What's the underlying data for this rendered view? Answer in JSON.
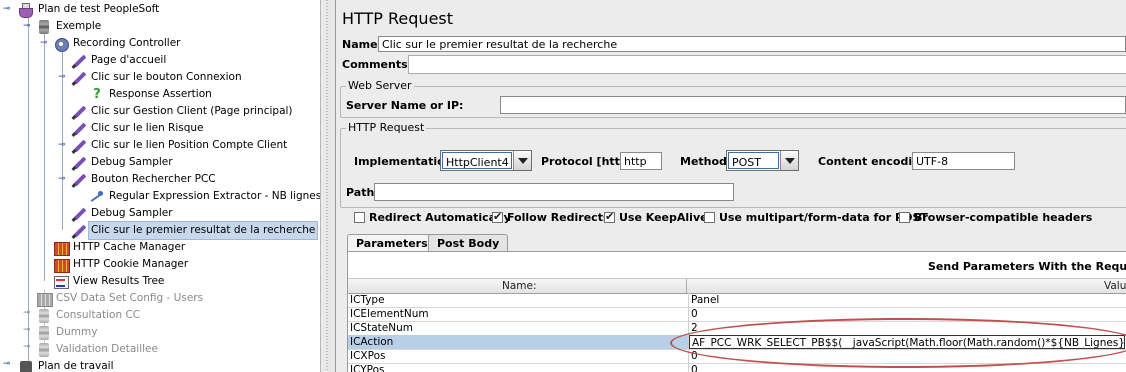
{
  "tree": {
    "items": [
      {
        "label": "Plan de test PeopleSoft",
        "icon": "beaker-icon",
        "disabled": false
      },
      {
        "label": "Exemple",
        "icon": "thread-group-icon",
        "disabled": false
      },
      {
        "label": "Recording Controller",
        "icon": "recording-controller-icon",
        "disabled": false
      },
      {
        "label": "Page d'accueil",
        "icon": "sampler-icon",
        "disabled": false
      },
      {
        "label": "Clic sur le bouton Connexion",
        "icon": "sampler-icon",
        "disabled": false
      },
      {
        "label": "Response Assertion",
        "icon": "assertion-icon",
        "disabled": false
      },
      {
        "label": "Clic sur Gestion Client (Page principal)",
        "icon": "sampler-icon",
        "disabled": false
      },
      {
        "label": "Clic sur le lien Risque",
        "icon": "sampler-icon",
        "disabled": false
      },
      {
        "label": "Clic sur le lien Position Compte Client",
        "icon": "sampler-icon",
        "disabled": false
      },
      {
        "label": "Debug Sampler",
        "icon": "sampler-icon",
        "disabled": false
      },
      {
        "label": "Bouton Rechercher PCC",
        "icon": "sampler-icon",
        "disabled": false
      },
      {
        "label": "Regular Expression Extractor - NB lignes",
        "icon": "regex-extractor-icon",
        "disabled": false
      },
      {
        "label": "Debug Sampler",
        "icon": "sampler-icon",
        "disabled": false
      },
      {
        "label": "Clic sur le premier resultat de la recherche",
        "icon": "sampler-icon",
        "disabled": false,
        "selected": true
      },
      {
        "label": "HTTP Cache Manager",
        "icon": "config-element-icon",
        "disabled": false
      },
      {
        "label": "HTTP Cookie Manager",
        "icon": "config-element-icon",
        "disabled": false
      },
      {
        "label": "View Results Tree",
        "icon": "listener-icon",
        "disabled": false
      },
      {
        "label": "CSV Data Set Config - Users",
        "icon": "config-element-icon",
        "disabled": true
      },
      {
        "label": "Consultation CC",
        "icon": "thread-group-icon",
        "disabled": true
      },
      {
        "label": "Dummy",
        "icon": "thread-group-icon",
        "disabled": true
      },
      {
        "label": "Validation Detaillee",
        "icon": "thread-group-icon",
        "disabled": true
      },
      {
        "label": "Plan de travail",
        "icon": "workbench-icon",
        "disabled": false
      }
    ]
  },
  "panel": {
    "title": "HTTP Request",
    "name_label": "Name:",
    "name_value": "Clic sur le premier resultat de la recherche",
    "comments_label": "Comments:",
    "web_server": {
      "title": "Web Server",
      "server_label": "Server Name or IP:",
      "server_value": ""
    },
    "http_request": {
      "title": "HTTP Request",
      "implementation_label": "Implementation:",
      "implementation_value": "HttpClient4",
      "protocol_label": "Protocol [http]:",
      "protocol_value": "http",
      "method_label": "Method:",
      "method_value": "POST",
      "encoding_label": "Content encoding:",
      "encoding_value": "UTF-8",
      "path_label": "Path:",
      "path_value": ""
    },
    "options": [
      {
        "label": "Redirect Automatically",
        "checked": false
      },
      {
        "label": "Follow Redirects",
        "checked": true
      },
      {
        "label": "Use KeepAlive",
        "checked": true
      },
      {
        "label": "Use multipart/form-data for POST",
        "checked": false
      },
      {
        "label": "Browser-compatible headers",
        "checked": false
      }
    ],
    "tabs": [
      {
        "label": "Parameters",
        "active": true
      },
      {
        "label": "Post Body",
        "active": false
      }
    ],
    "params": {
      "heading": "Send Parameters With the Request:",
      "col_name": "Name:",
      "col_value": "Valu",
      "rows": [
        {
          "name": "ICType",
          "value": "Panel"
        },
        {
          "name": "ICElementNum",
          "value": "0"
        },
        {
          "name": "ICStateNum",
          "value": "2"
        },
        {
          "name": "ICAction",
          "value": "AF_PCC_WRK_SELECT_PB$$(__javaScript(Math.floor(Math.random()*${NB_Lignes})))",
          "selected": true
        },
        {
          "name": "ICXPos",
          "value": "0"
        },
        {
          "name": "ICYPos",
          "value": "0"
        }
      ]
    }
  },
  "colors": {
    "selection": "#c8d8ec",
    "annotation": "#c0504d",
    "panel_bg": "#ececec"
  }
}
